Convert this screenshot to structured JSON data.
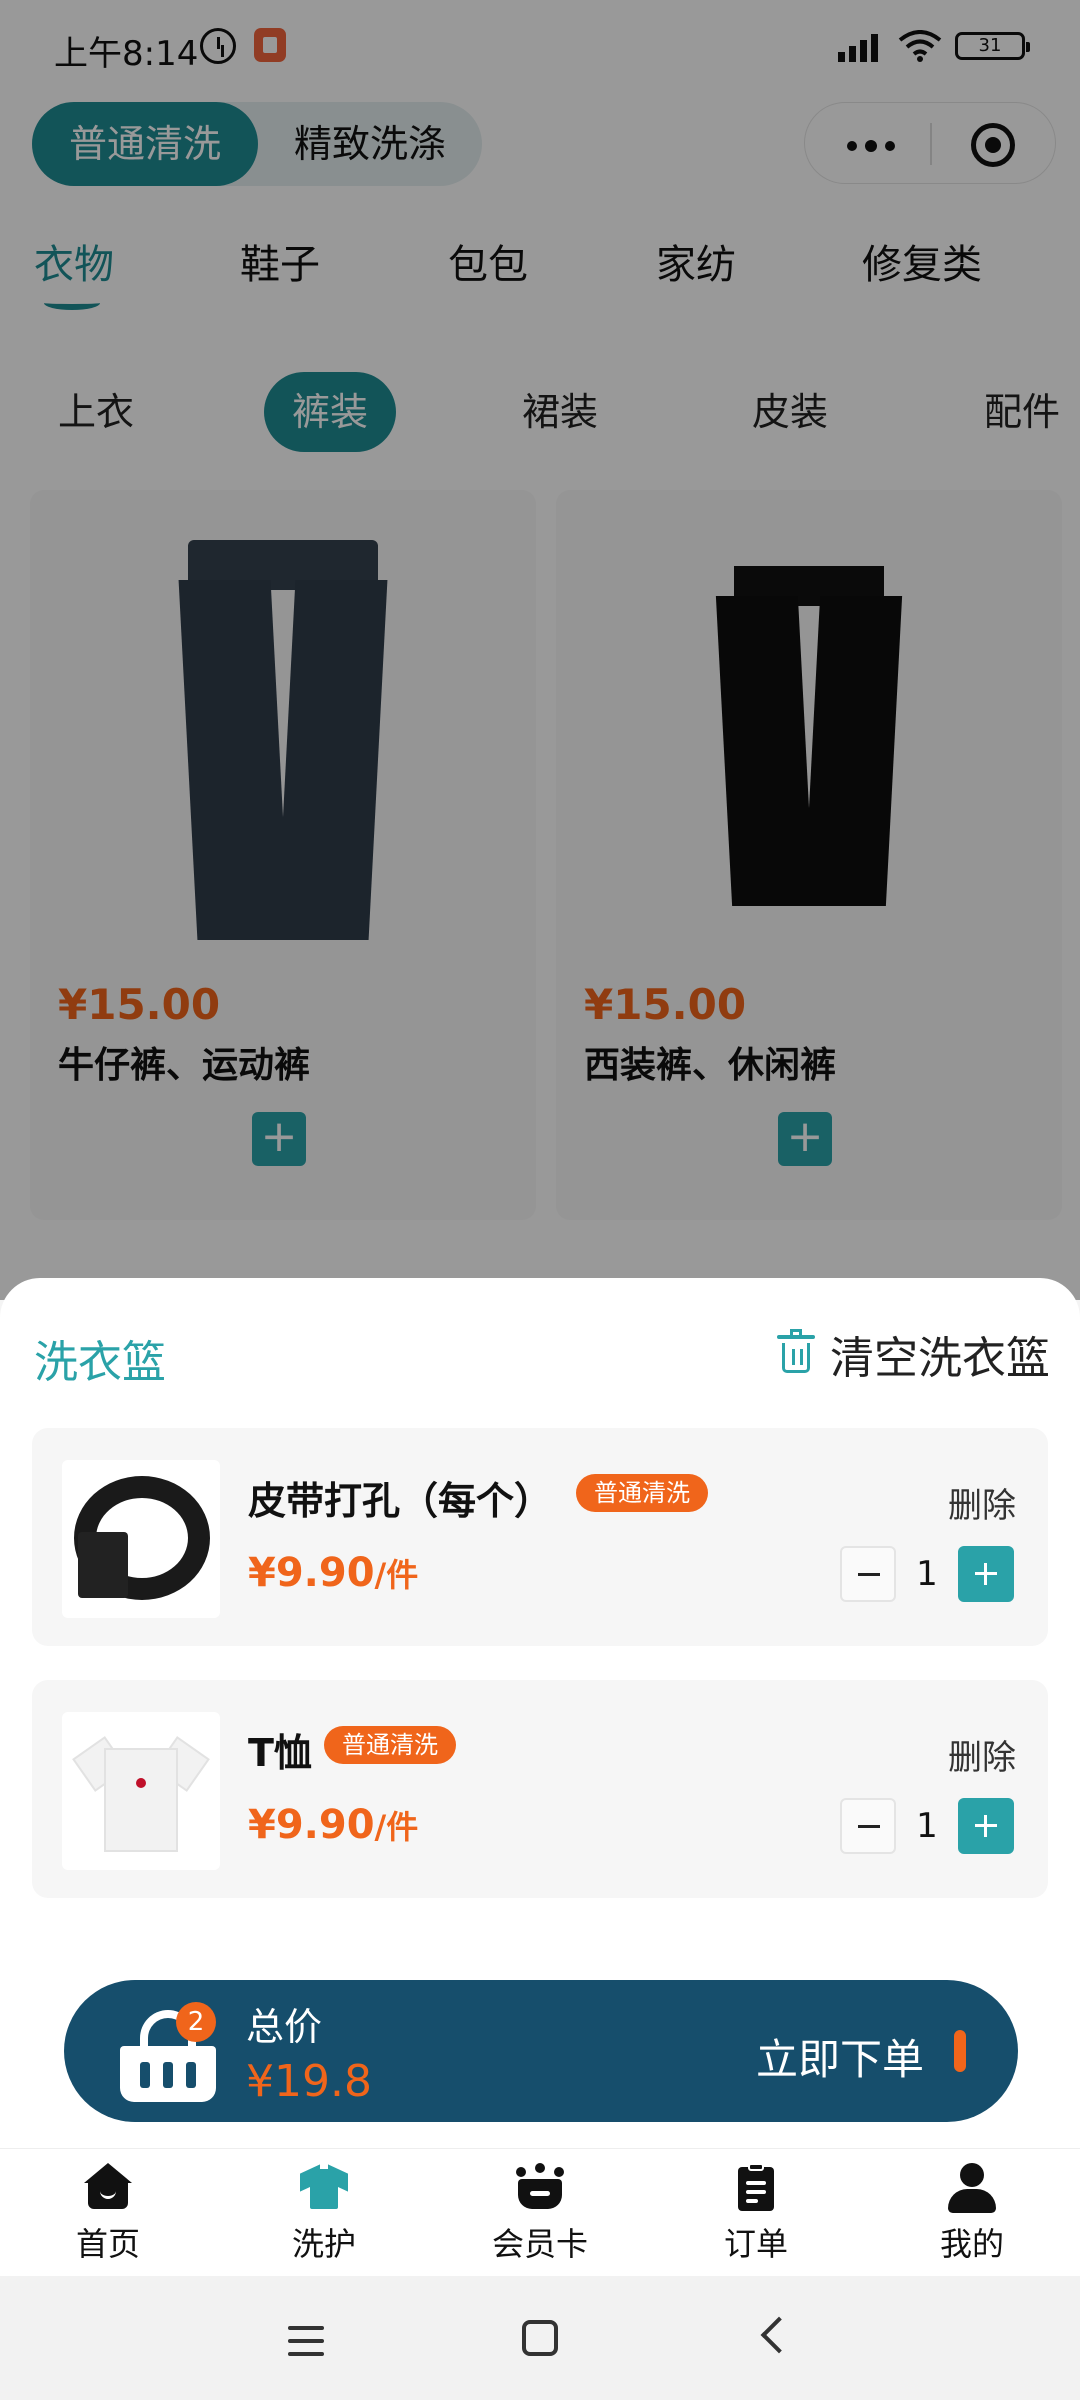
{
  "status_bar": {
    "time": "上午8:14",
    "battery": "31"
  },
  "mode_switch": {
    "active": "普通清洗",
    "inactive": "精致洗涤"
  },
  "category_tabs": [
    "衣物",
    "鞋子",
    "包包",
    "家纺",
    "修复类"
  ],
  "sub_tabs": [
    "上衣",
    "裤装",
    "裙装",
    "皮装",
    "配件"
  ],
  "products": [
    {
      "price": "¥15.00",
      "name": "牛仔裤、运动裤",
      "add": "+"
    },
    {
      "price": "¥15.00",
      "name": "西装裤、休闲裤",
      "add": "+"
    }
  ],
  "basket": {
    "title": "洗衣篮",
    "clear_label": "清空洗衣篮",
    "items": [
      {
        "name": "皮带打孔（每个）",
        "tag": "普通清洗",
        "price": "¥9.90",
        "unit": "/件",
        "delete": "删除",
        "qty": "1"
      },
      {
        "name": "T恤",
        "tag": "普通清洗",
        "price": "¥9.90",
        "unit": "/件",
        "delete": "删除",
        "qty": "1"
      }
    ]
  },
  "checkout": {
    "count": "2",
    "total_label": "总价",
    "total_value": "¥19.8",
    "order_label": "立即下单"
  },
  "bottom_nav": [
    {
      "label": "首页",
      "icon": "home-icon"
    },
    {
      "label": "洗护",
      "icon": "shirt-icon"
    },
    {
      "label": "会员卡",
      "icon": "crown-icon"
    },
    {
      "label": "订单",
      "icon": "order-icon"
    },
    {
      "label": "我的",
      "icon": "user-icon"
    }
  ],
  "colors": {
    "accent": "#2aa2a8",
    "primary": "#1f8c93",
    "price": "#f0651b",
    "checkout_bg": "#164e6c"
  }
}
